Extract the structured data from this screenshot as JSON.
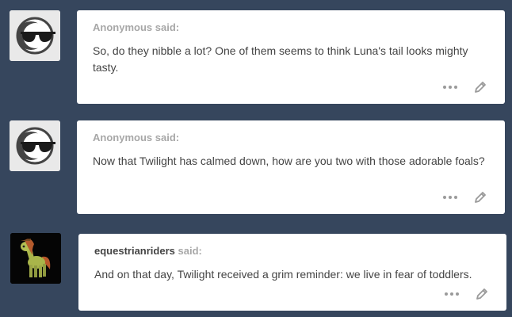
{
  "posts": [
    {
      "asker": "Anonymous",
      "said": "said:",
      "text": "So, do they nibble a lot? One of them seems to think Luna's tail looks mighty tasty.",
      "avatar": "anonymous-sunglasses-avatar"
    },
    {
      "asker": "Anonymous",
      "said": "said:",
      "text": "Now that Twilight has calmed down, how are you two with those adorable foals?",
      "avatar": "anonymous-sunglasses-avatar"
    },
    {
      "asker": "equestrianriders",
      "said": "said:",
      "text": "And on that day, Twilight received a grim reminder: we live in fear of toddlers.",
      "avatar": "pony-figure-avatar"
    }
  ],
  "icons": {
    "more": "more-options-icon",
    "edit": "edit-pencil-icon"
  },
  "colors": {
    "background": "#36465d",
    "card": "#ffffff",
    "asker_text": "#a7a7a7",
    "body_text": "#444444"
  }
}
